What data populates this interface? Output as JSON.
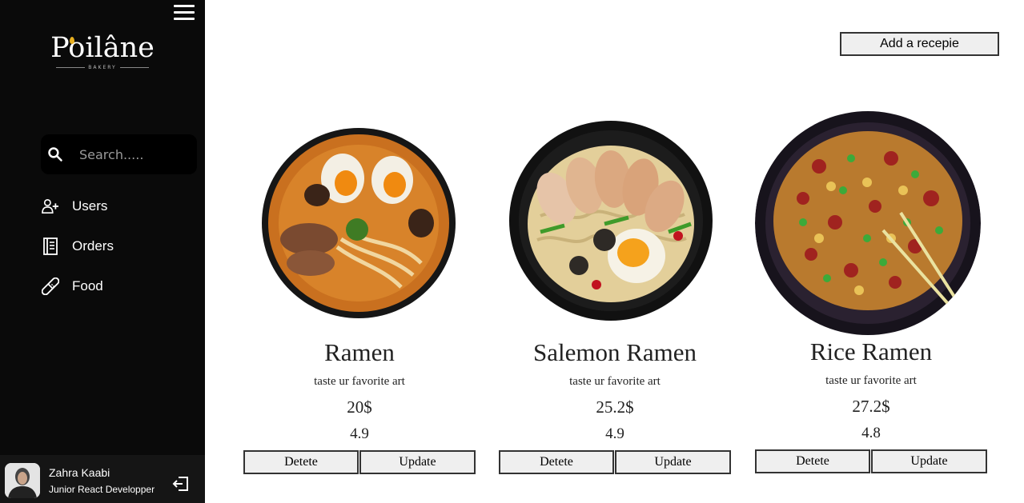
{
  "sidebar": {
    "logo": {
      "word": "Poilâne",
      "sub": "BAKERY"
    },
    "search": {
      "placeholder": "Search....."
    },
    "items": [
      {
        "label": "Users",
        "icon": "user-plus-icon"
      },
      {
        "label": "Orders",
        "icon": "notebook-icon"
      },
      {
        "label": "Food",
        "icon": "pill-icon"
      }
    ],
    "profile": {
      "name": "Zahra Kaabi",
      "role": "Junior React Developper"
    }
  },
  "main": {
    "add_label": "Add a recepie",
    "cards": [
      {
        "title": "Ramen",
        "description": "taste ur favorite art",
        "price": "20$",
        "rating": "4.9",
        "delete_label": "Detete",
        "update_label": "Update"
      },
      {
        "title": "Salemon Ramen",
        "description": "taste ur favorite art",
        "price": "25.2$",
        "rating": "4.9",
        "delete_label": "Detete",
        "update_label": "Update"
      },
      {
        "title": "Rice Ramen",
        "description": "taste ur favorite art",
        "price": "27.2$",
        "rating": "4.8",
        "delete_label": "Detete",
        "update_label": "Update"
      }
    ]
  },
  "colors": {
    "sidebar_bg": "#0a0a0a",
    "button_bg": "#efefef",
    "logo_accent": "#e8b020"
  }
}
